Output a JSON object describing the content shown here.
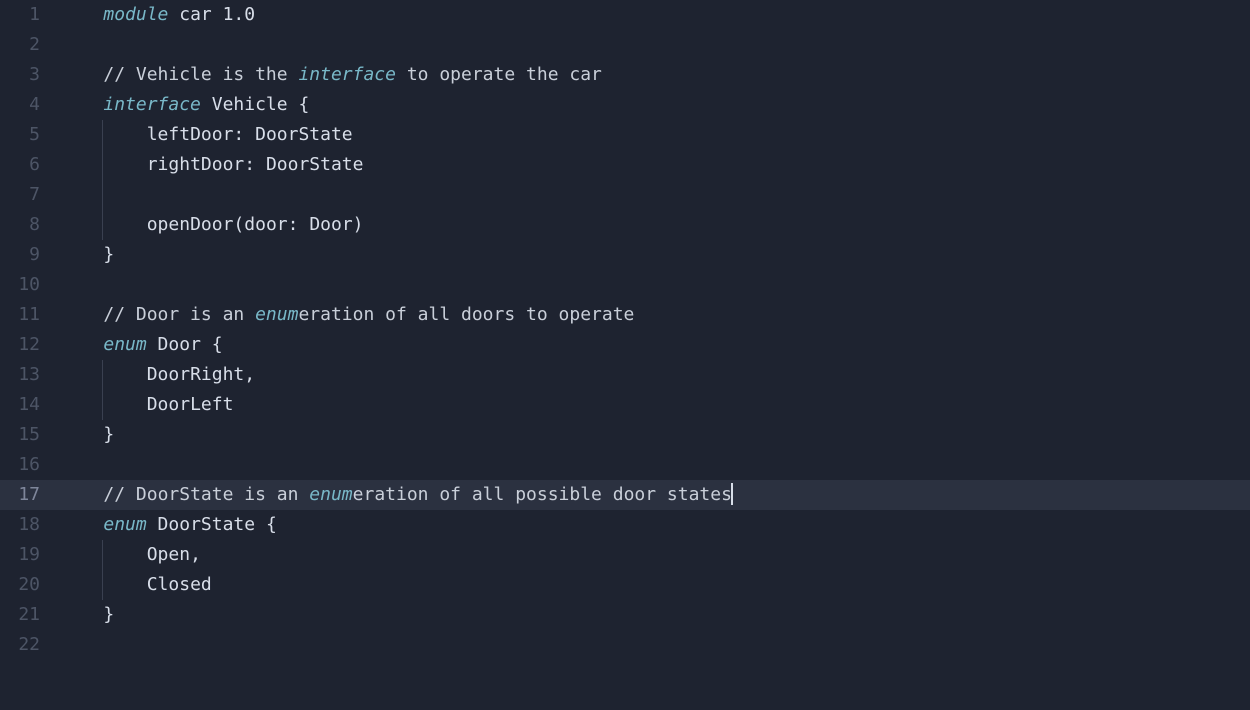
{
  "editor": {
    "active_line": 17,
    "cursor_after_token": "l17_t6",
    "lines": [
      {
        "n": 1,
        "indent": 0,
        "tokens": [
          {
            "id": "l1_t0",
            "cls": "tok-kw",
            "t": "module"
          },
          {
            "id": "l1_t1",
            "cls": "tok-ident",
            "t": " car "
          },
          {
            "id": "l1_t2",
            "cls": "tok-num",
            "t": "1.0"
          }
        ]
      },
      {
        "n": 2,
        "indent": 0,
        "tokens": []
      },
      {
        "n": 3,
        "indent": 0,
        "tokens": [
          {
            "id": "l3_t0",
            "cls": "tok-comment",
            "t": "// Vehicle is the "
          },
          {
            "id": "l3_t1",
            "cls": "tok-comment-kw",
            "t": "interface"
          },
          {
            "id": "l3_t2",
            "cls": "tok-comment",
            "t": " to operate the car"
          }
        ]
      },
      {
        "n": 4,
        "indent": 0,
        "tokens": [
          {
            "id": "l4_t0",
            "cls": "tok-kw",
            "t": "interface"
          },
          {
            "id": "l4_t1",
            "cls": "tok-ident",
            "t": " Vehicle "
          },
          {
            "id": "l4_t2",
            "cls": "tok-punct",
            "t": "{"
          }
        ]
      },
      {
        "n": 5,
        "indent": 1,
        "tokens": [
          {
            "id": "l5_t0",
            "cls": "tok-ident",
            "t": "leftDoor"
          },
          {
            "id": "l5_t1",
            "cls": "tok-punct",
            "t": ": "
          },
          {
            "id": "l5_t2",
            "cls": "tok-ident",
            "t": "DoorState"
          }
        ]
      },
      {
        "n": 6,
        "indent": 1,
        "tokens": [
          {
            "id": "l6_t0",
            "cls": "tok-ident",
            "t": "rightDoor"
          },
          {
            "id": "l6_t1",
            "cls": "tok-punct",
            "t": ": "
          },
          {
            "id": "l6_t2",
            "cls": "tok-ident",
            "t": "DoorState"
          }
        ]
      },
      {
        "n": 7,
        "indent": 1,
        "tokens": []
      },
      {
        "n": 8,
        "indent": 1,
        "tokens": [
          {
            "id": "l8_t0",
            "cls": "tok-ident",
            "t": "openDoor"
          },
          {
            "id": "l8_t1",
            "cls": "tok-punct",
            "t": "("
          },
          {
            "id": "l8_t2",
            "cls": "tok-ident",
            "t": "door"
          },
          {
            "id": "l8_t3",
            "cls": "tok-punct",
            "t": ": "
          },
          {
            "id": "l8_t4",
            "cls": "tok-ident",
            "t": "Door"
          },
          {
            "id": "l8_t5",
            "cls": "tok-punct",
            "t": ")"
          }
        ]
      },
      {
        "n": 9,
        "indent": 0,
        "tokens": [
          {
            "id": "l9_t0",
            "cls": "tok-punct",
            "t": "}"
          }
        ]
      },
      {
        "n": 10,
        "indent": 0,
        "tokens": []
      },
      {
        "n": 11,
        "indent": 0,
        "tokens": [
          {
            "id": "l11_t0",
            "cls": "tok-comment",
            "t": "// Door is an "
          },
          {
            "id": "l11_t1",
            "cls": "tok-comment-kw",
            "t": "enum"
          },
          {
            "id": "l11_t2",
            "cls": "tok-comment",
            "t": "eration of all doors to operate"
          }
        ]
      },
      {
        "n": 12,
        "indent": 0,
        "tokens": [
          {
            "id": "l12_t0",
            "cls": "tok-kw",
            "t": "enum"
          },
          {
            "id": "l12_t1",
            "cls": "tok-ident",
            "t": " Door "
          },
          {
            "id": "l12_t2",
            "cls": "tok-punct",
            "t": "{"
          }
        ]
      },
      {
        "n": 13,
        "indent": 1,
        "tokens": [
          {
            "id": "l13_t0",
            "cls": "tok-ident",
            "t": "DoorRight"
          },
          {
            "id": "l13_t1",
            "cls": "tok-punct",
            "t": ","
          }
        ]
      },
      {
        "n": 14,
        "indent": 1,
        "tokens": [
          {
            "id": "l14_t0",
            "cls": "tok-ident",
            "t": "DoorLeft"
          }
        ]
      },
      {
        "n": 15,
        "indent": 0,
        "tokens": [
          {
            "id": "l15_t0",
            "cls": "tok-punct",
            "t": "}"
          }
        ]
      },
      {
        "n": 16,
        "indent": 0,
        "tokens": []
      },
      {
        "n": 17,
        "indent": 0,
        "tokens": [
          {
            "id": "l17_t0",
            "cls": "tok-comment",
            "t": "/"
          },
          {
            "id": "l17_t1",
            "cls": "tok-comment",
            "t": "/"
          },
          {
            "id": "l17_t2",
            "cls": "tok-comment",
            "t": " "
          },
          {
            "id": "l17_t3",
            "cls": "tok-comment",
            "t": "DoorState is an "
          },
          {
            "id": "l17_t4",
            "cls": "tok-comment-kw",
            "t": "enum"
          },
          {
            "id": "l17_t5",
            "cls": "tok-comment",
            "t": "eration of all possible door "
          },
          {
            "id": "l17_t6",
            "cls": "tok-comment",
            "t": "states"
          }
        ]
      },
      {
        "n": 18,
        "indent": 0,
        "tokens": [
          {
            "id": "l18_t0",
            "cls": "tok-kw",
            "t": "enum"
          },
          {
            "id": "l18_t1",
            "cls": "tok-ident",
            "t": " DoorState "
          },
          {
            "id": "l18_t2",
            "cls": "tok-punct",
            "t": "{"
          }
        ]
      },
      {
        "n": 19,
        "indent": 1,
        "tokens": [
          {
            "id": "l19_t0",
            "cls": "tok-ident",
            "t": "Open"
          },
          {
            "id": "l19_t1",
            "cls": "tok-punct",
            "t": ","
          }
        ]
      },
      {
        "n": 20,
        "indent": 1,
        "tokens": [
          {
            "id": "l20_t0",
            "cls": "tok-ident",
            "t": "Closed"
          }
        ]
      },
      {
        "n": 21,
        "indent": 0,
        "tokens": [
          {
            "id": "l21_t0",
            "cls": "tok-punct",
            "t": "}"
          }
        ]
      },
      {
        "n": 22,
        "indent": 0,
        "tokens": []
      }
    ]
  }
}
